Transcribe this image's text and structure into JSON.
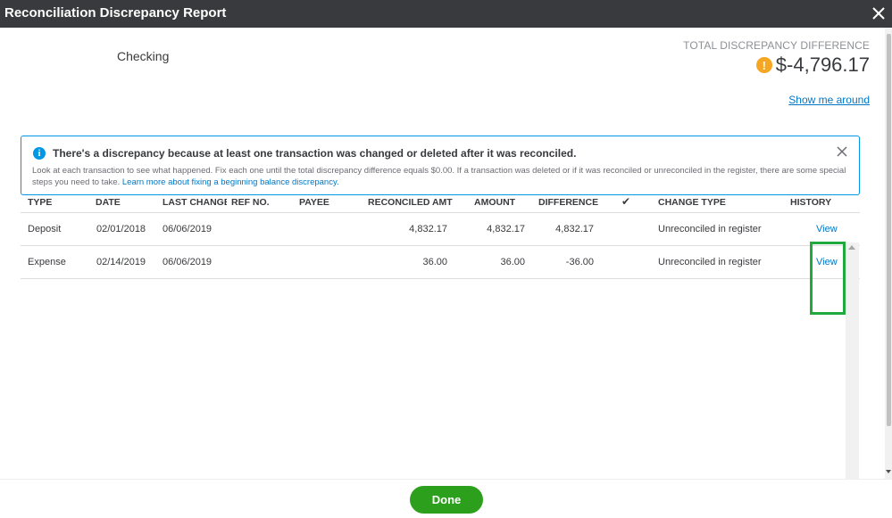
{
  "window": {
    "title": "Reconciliation Discrepancy Report"
  },
  "account": {
    "name": "Checking"
  },
  "discrepancy": {
    "label": "TOTAL DISCREPANCY DIFFERENCE",
    "amount": "$-4,796.17",
    "warning_icon": "!"
  },
  "show_me_around": "Show me around",
  "alert": {
    "headline": "There's a discrepancy because at least one transaction was changed or deleted after it was reconciled.",
    "body": "Look at each transaction to see what happened. Fix each one until the total discrepancy difference equals $0.00. If a transaction was deleted or if it was reconciled or unreconciled in the register, there are some special steps you need to take.",
    "link": "Learn more about fixing a beginning balance discrepancy."
  },
  "table": {
    "headers": {
      "type": "TYPE",
      "date": "DATE",
      "last_changed": "LAST CHANGED",
      "ref_no": "REF NO.",
      "payee": "PAYEE",
      "reconciled_amt": "RECONCILED AMT",
      "amount": "AMOUNT",
      "difference": "DIFFERENCE",
      "check": "✔",
      "change_type": "CHANGE TYPE",
      "history": "HISTORY"
    },
    "rows": [
      {
        "type": "Deposit",
        "date": "02/01/2018",
        "last_changed": "06/06/2019",
        "ref_no": "",
        "payee": "",
        "reconciled_amt": "4,832.17",
        "amount": "4,832.17",
        "difference": "4,832.17",
        "change_type": "Unreconciled in register",
        "history": "View"
      },
      {
        "type": "Expense",
        "date": "02/14/2019",
        "last_changed": "06/06/2019",
        "ref_no": "",
        "payee": "",
        "reconciled_amt": "36.00",
        "amount": "36.00",
        "difference": "-36.00",
        "change_type": "Unreconciled in register",
        "history": "View"
      }
    ]
  },
  "footer": {
    "done_label": "Done"
  },
  "colors": {
    "header_bg": "#393a3d",
    "accent_green": "#2ca01c",
    "link_blue": "#0077c5",
    "warning": "#f5a623",
    "highlight_green": "#1faa3f"
  }
}
